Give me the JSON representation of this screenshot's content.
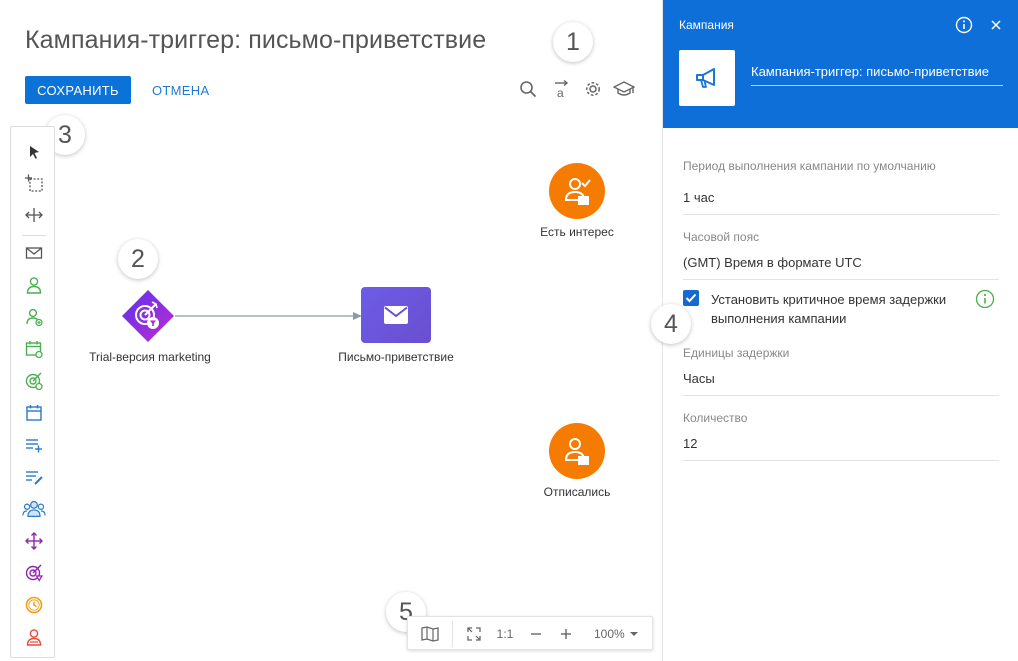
{
  "page": {
    "title": "Кампания-триггер: письмо-приветствие",
    "save_label": "СОХРАНИТЬ",
    "cancel_label": "ОТМЕНА"
  },
  "toolbar": {
    "icons": [
      "search-icon",
      "text-position-icon",
      "gear-icon",
      "academy-icon"
    ]
  },
  "callouts": [
    "1",
    "2",
    "3",
    "4",
    "5"
  ],
  "palette": {
    "items": [
      "cursor-icon",
      "lasso-selection-icon",
      "move-space-icon",
      "email-icon",
      "audience-icon",
      "add-audience-icon",
      "event-audience-icon",
      "goal-audience-icon",
      "calendar-timer-icon",
      "add-record-icon",
      "edit-record-icon",
      "group-icon",
      "split-icon",
      "exit-goal-icon",
      "timer-icon",
      "exit-audience-icon"
    ]
  },
  "flow": {
    "nodes": [
      {
        "id": "trial",
        "label": "Trial-версия marketing"
      },
      {
        "id": "welcome",
        "label": "Письмо-приветствие"
      },
      {
        "id": "interest",
        "label": "Есть интерес"
      },
      {
        "id": "unsub",
        "label": "Отписались"
      }
    ]
  },
  "zoombar": {
    "map_icon": "minimap-icon",
    "fit_icon": "fit-screen-icon",
    "actual_label": "1:1",
    "minus_icon": "zoom-out-icon",
    "plus_icon": "zoom-in-icon",
    "zoom_value": "100%"
  },
  "panel": {
    "caption": "Кампания",
    "name": "Кампания-триггер: письмо-приветствие",
    "fields": {
      "period_label": "Период выполнения кампании по умолчанию",
      "period_value": "1 час",
      "tz_label": "Часовой пояс",
      "tz_value": "(GMT) Время в формате UTC",
      "critical_label": "Установить критичное время задержки выполнения кампании",
      "critical_checked": true,
      "units_label": "Единицы задержки",
      "units_value": "Часы",
      "qty_label": "Количество",
      "qty_value": "12"
    }
  },
  "colors": {
    "primary": "#0b72d8",
    "panel_header": "#0d6fd7",
    "node_orange": "#f57c00",
    "node_email": "#6f50d9",
    "node_trigger": "#7a2be0",
    "palette_green": "#4caf50",
    "palette_purple": "#8e24aa",
    "palette_orange": "#f39c12",
    "palette_red": "#e74c3c"
  }
}
